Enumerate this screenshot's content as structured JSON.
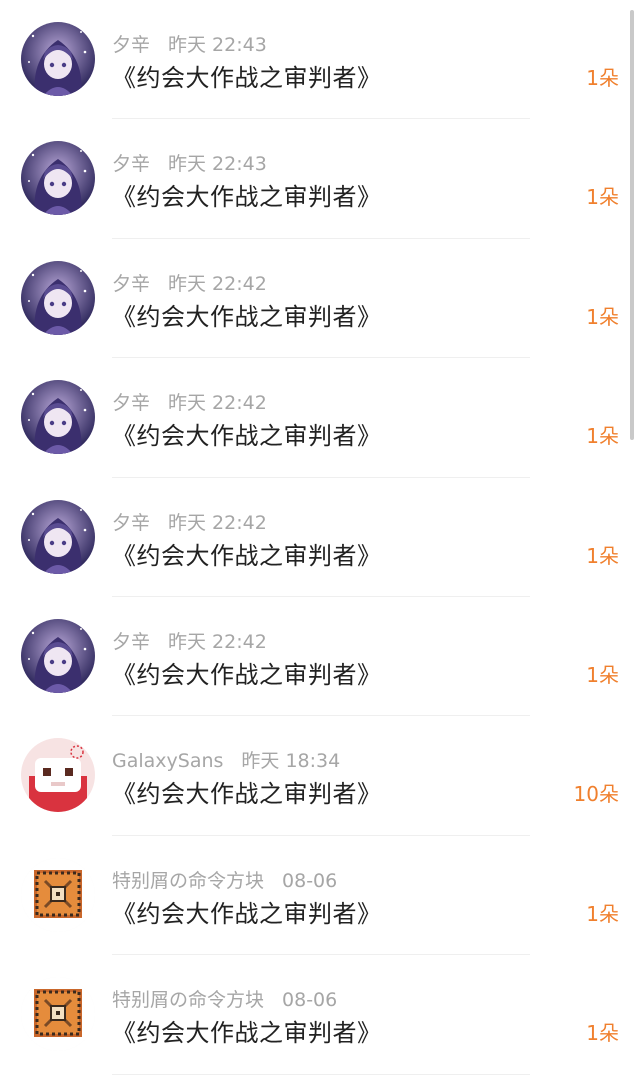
{
  "colors": {
    "accent": "#f0802e",
    "meta": "#a6a6a6",
    "title": "#222222"
  },
  "rows": [
    {
      "user": "夕辛",
      "time": "昨天 22:43",
      "title": "《约会大作战之审判者》",
      "count": "1朵",
      "avatar": "anime-girl-avatar"
    },
    {
      "user": "夕辛",
      "time": "昨天 22:43",
      "title": "《约会大作战之审判者》",
      "count": "1朵",
      "avatar": "anime-girl-avatar"
    },
    {
      "user": "夕辛",
      "time": "昨天 22:42",
      "title": "《约会大作战之审判者》",
      "count": "1朵",
      "avatar": "anime-girl-avatar"
    },
    {
      "user": "夕辛",
      "time": "昨天 22:42",
      "title": "《约会大作战之审判者》",
      "count": "1朵",
      "avatar": "anime-girl-avatar"
    },
    {
      "user": "夕辛",
      "time": "昨天 22:42",
      "title": "《约会大作战之审判者》",
      "count": "1朵",
      "avatar": "anime-girl-avatar"
    },
    {
      "user": "夕辛",
      "time": "昨天 22:42",
      "title": "《约会大作战之审判者》",
      "count": "1朵",
      "avatar": "anime-girl-avatar"
    },
    {
      "user": "GalaxySans",
      "time": "昨天 18:34",
      "title": "《约会大作战之审判者》",
      "count": "10朵",
      "avatar": "pixel-character-avatar"
    },
    {
      "user": "特别屑の命令方块",
      "time": "08-06",
      "title": "《约会大作战之审判者》",
      "count": "1朵",
      "avatar": "command-block-avatar"
    },
    {
      "user": "特别屑の命令方块",
      "time": "08-06",
      "title": "《约会大作战之审判者》",
      "count": "1朵",
      "avatar": "command-block-avatar"
    }
  ]
}
